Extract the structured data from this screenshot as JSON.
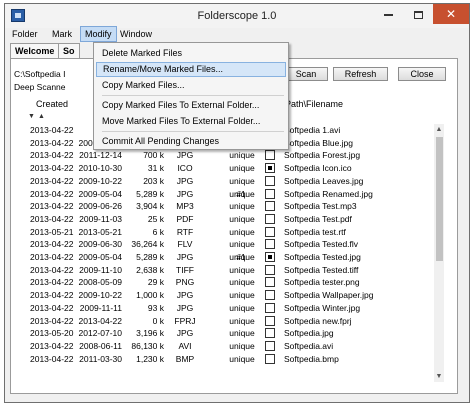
{
  "window": {
    "title": "Folderscope 1.0"
  },
  "menubar": {
    "items": [
      "Folder",
      "Mark",
      "Modify",
      "Window"
    ]
  },
  "tabs": [
    "Welcome",
    "So"
  ],
  "toolbar": {
    "path_value": "C:\\Softpedia I",
    "scan_value": "Deep Scanne",
    "scan_label": "Scan",
    "refresh_label": "Refresh",
    "close_label": "Close"
  },
  "columns": {
    "created": "Created",
    "path": "Path\\Filename"
  },
  "filter_glyphs": [
    "▼",
    "▲",
    "▼",
    "▼",
    "▼",
    "▼",
    "▼",
    "▼"
  ],
  "dropdown": {
    "items": [
      "Delete Marked Files",
      "Rename/Move Marked Files...",
      "Copy Marked Files...",
      "Copy Marked Files To External Folder...",
      "Move Marked Files To External Folder...",
      "Commit All Pending Changes"
    ],
    "highlighted_index": 1
  },
  "rows": [
    {
      "created": "2013-04-22",
      "modified": "",
      "size": "",
      "ext": "",
      "unique": "",
      "group": "",
      "marked": false,
      "name": "Softpedia 1.avi"
    },
    {
      "created": "2013-04-22",
      "modified": "2009-10-22",
      "size": "102 k",
      "ext": "JPG",
      "unique": "unique",
      "group": "",
      "marked": false,
      "name": "Softpedia Blue.jpg"
    },
    {
      "created": "2013-04-22",
      "modified": "2011-12-14",
      "size": "700 k",
      "ext": "JPG",
      "unique": "unique",
      "group": "",
      "marked": false,
      "name": "Softpedia Forest.jpg"
    },
    {
      "created": "2013-04-22",
      "modified": "2010-10-30",
      "size": "31 k",
      "ext": "ICO",
      "unique": "unique",
      "group": "",
      "marked": true,
      "name": "Softpedia Icon.ico"
    },
    {
      "created": "2013-04-22",
      "modified": "2009-10-22",
      "size": "203 k",
      "ext": "JPG",
      "unique": "unique",
      "group": "",
      "marked": false,
      "name": "Softpedia Leaves.jpg"
    },
    {
      "created": "2013-04-22",
      "modified": "2009-05-04",
      "size": "5,289 k",
      "ext": "JPG",
      "unique": "unique",
      "group": "#1",
      "marked": false,
      "name": "Softpedia Renamed.jpg"
    },
    {
      "created": "2013-04-22",
      "modified": "2009-06-26",
      "size": "3,904 k",
      "ext": "MP3",
      "unique": "unique",
      "group": "",
      "marked": false,
      "name": "Softpedia Test.mp3"
    },
    {
      "created": "2013-04-22",
      "modified": "2009-11-03",
      "size": "25 k",
      "ext": "PDF",
      "unique": "unique",
      "group": "",
      "marked": false,
      "name": "Softpedia Test.pdf"
    },
    {
      "created": "2013-05-21",
      "modified": "2013-05-21",
      "size": "6 k",
      "ext": "RTF",
      "unique": "unique",
      "group": "",
      "marked": false,
      "name": "Softpedia test.rtf"
    },
    {
      "created": "2013-04-22",
      "modified": "2009-06-30",
      "size": "36,264 k",
      "ext": "FLV",
      "unique": "unique",
      "group": "",
      "marked": false,
      "name": "Softpedia Tested.flv"
    },
    {
      "created": "2013-04-22",
      "modified": "2009-05-04",
      "size": "5,289 k",
      "ext": "JPG",
      "unique": "unique",
      "group": "#1",
      "marked": true,
      "name": "Softpedia Tested.jpg"
    },
    {
      "created": "2013-04-22",
      "modified": "2009-11-10",
      "size": "2,638 k",
      "ext": "TIFF",
      "unique": "unique",
      "group": "",
      "marked": false,
      "name": "Softpedia Tested.tiff"
    },
    {
      "created": "2013-04-22",
      "modified": "2008-05-09",
      "size": "29 k",
      "ext": "PNG",
      "unique": "unique",
      "group": "",
      "marked": false,
      "name": "Softpedia tester.png"
    },
    {
      "created": "2013-04-22",
      "modified": "2009-10-22",
      "size": "1,000 k",
      "ext": "JPG",
      "unique": "unique",
      "group": "",
      "marked": false,
      "name": "Softpedia Wallpaper.jpg"
    },
    {
      "created": "2013-04-22",
      "modified": "2009-11-11",
      "size": "93 k",
      "ext": "JPG",
      "unique": "unique",
      "group": "",
      "marked": false,
      "name": "Softpedia Winter.jpg"
    },
    {
      "created": "2013-04-22",
      "modified": "2013-04-22",
      "size": "0 k",
      "ext": "FPRJ",
      "unique": "unique",
      "group": "",
      "marked": false,
      "name": "Softpedia new.fprj"
    },
    {
      "created": "2013-05-20",
      "modified": "2012-07-10",
      "size": "3,196 k",
      "ext": "JPG",
      "unique": "unique",
      "group": "",
      "marked": false,
      "name": "Softpedia.jpg"
    },
    {
      "created": "2013-04-22",
      "modified": "2008-06-11",
      "size": "86,130 k",
      "ext": "AVI",
      "unique": "unique",
      "group": "",
      "marked": false,
      "name": "Softpedia.avi"
    },
    {
      "created": "2013-04-22",
      "modified": "2011-03-30",
      "size": "1,230 k",
      "ext": "BMP",
      "unique": "unique",
      "group": "",
      "marked": false,
      "name": "Softpedia.bmp"
    }
  ]
}
